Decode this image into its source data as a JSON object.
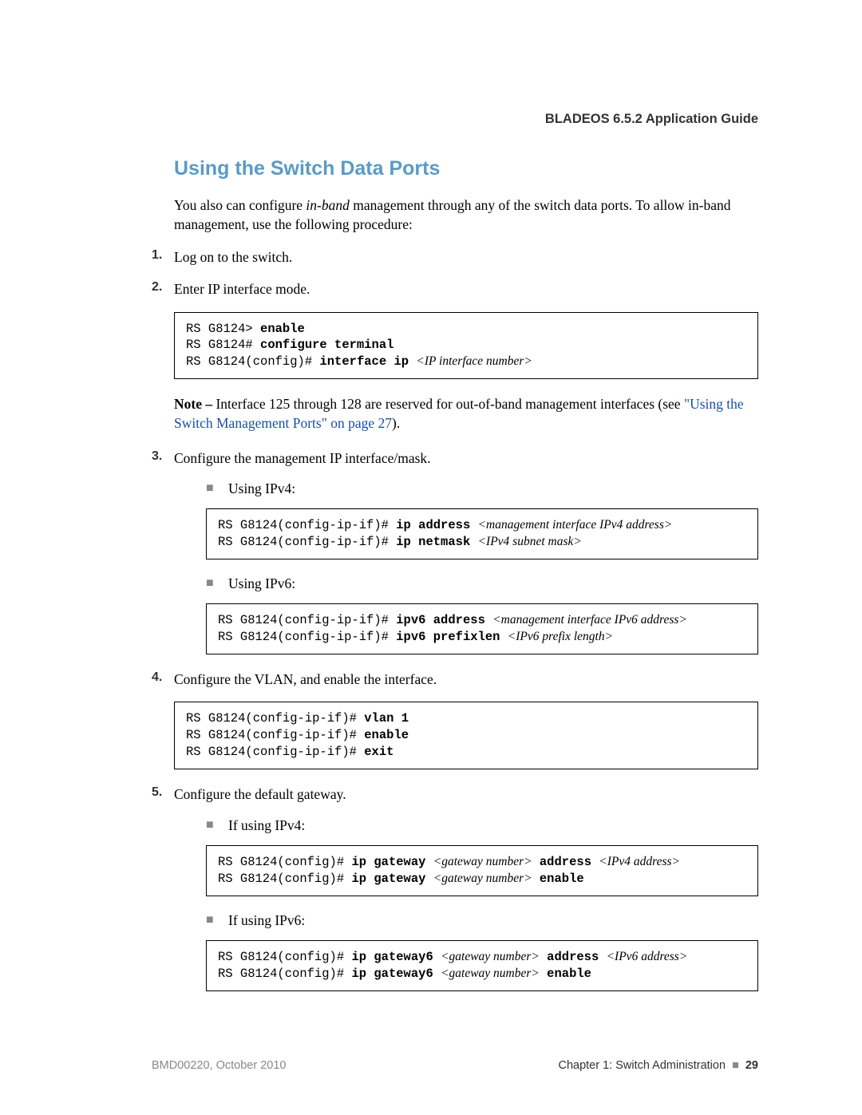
{
  "header": {
    "title": "BLADEOS 6.5.2 Application Guide"
  },
  "section": {
    "heading": "Using the Switch Data Ports"
  },
  "intro": {
    "p1a": "You also can configure ",
    "p1_italic": "in-band",
    "p1b": " management through any of the switch data ports. To allow in-band management, use the following procedure:"
  },
  "steps": {
    "s1": {
      "num": "1.",
      "text": "Log on to the switch."
    },
    "s2": {
      "num": "2.",
      "text": "Enter IP interface mode."
    },
    "s3": {
      "num": "3.",
      "text": "Configure the management IP interface/mask."
    },
    "s4": {
      "num": "4.",
      "text": "Configure the VLAN, and enable the interface."
    },
    "s5": {
      "num": "5.",
      "text": "Configure the default gateway."
    }
  },
  "code1": {
    "l1a": "RS G8124> ",
    "l1b": "enable",
    "l2a": "RS G8124# ",
    "l2b": "configure terminal",
    "l3a": "RS G8124(config)# ",
    "l3b": "interface ip ",
    "l3c": "<IP interface number>"
  },
  "note": {
    "label": "Note – ",
    "t1": "Interface 125 through 128 are reserved for out-of-band management interfaces (see ",
    "link": "\"Using the Switch Management Ports\" on page 27",
    "t2": ")."
  },
  "sub": {
    "ipv4": "Using IPv4:",
    "ipv6": "Using IPv6:",
    "ifipv4": "If using IPv4:",
    "ifipv6": "If using IPv6:"
  },
  "code_ipv4": {
    "l1a": "RS G8124(config-ip-if)# ",
    "l1b": "ip address ",
    "l1c": "<management interface IPv4 address>",
    "l2a": "RS G8124(config-ip-if)# ",
    "l2b": "ip netmask ",
    "l2c": "<IPv4 subnet mask>"
  },
  "code_ipv6": {
    "l1a": "RS G8124(config-ip-if)# ",
    "l1b": "ipv6 address ",
    "l1c": "<management interface IPv6 address>",
    "l2a": "RS G8124(config-ip-if)# ",
    "l2b": "ipv6 prefixlen ",
    "l2c": "<IPv6 prefix length>"
  },
  "code_vlan": {
    "l1a": "RS G8124(config-ip-if)# ",
    "l1b": "vlan 1",
    "l2a": "RS G8124(config-ip-if)# ",
    "l2b": "enable",
    "l3a": "RS G8124(config-ip-if)# ",
    "l3b": "exit"
  },
  "code_gw4": {
    "l1a": "RS G8124(config)# ",
    "l1b": "ip gateway ",
    "l1c": "<gateway number>",
    "l1d": " address ",
    "l1e": "<IPv4 address>",
    "l2a": "RS G8124(config)# ",
    "l2b": "ip gateway ",
    "l2c": "<gateway number>",
    "l2d": " enable"
  },
  "code_gw6": {
    "l1a": "RS G8124(config)# ",
    "l1b": "ip gateway6 ",
    "l1c": "<gateway number>",
    "l1d": " address ",
    "l1e": "<IPv6 address>",
    "l2a": "RS G8124(config)# ",
    "l2b": "ip gateway6 ",
    "l2c": "<gateway number>",
    "l2d": " enable"
  },
  "footer": {
    "left": "BMD00220, October 2010",
    "chapter": "Chapter 1: Switch Administration",
    "bullet": "■",
    "page": "29"
  }
}
